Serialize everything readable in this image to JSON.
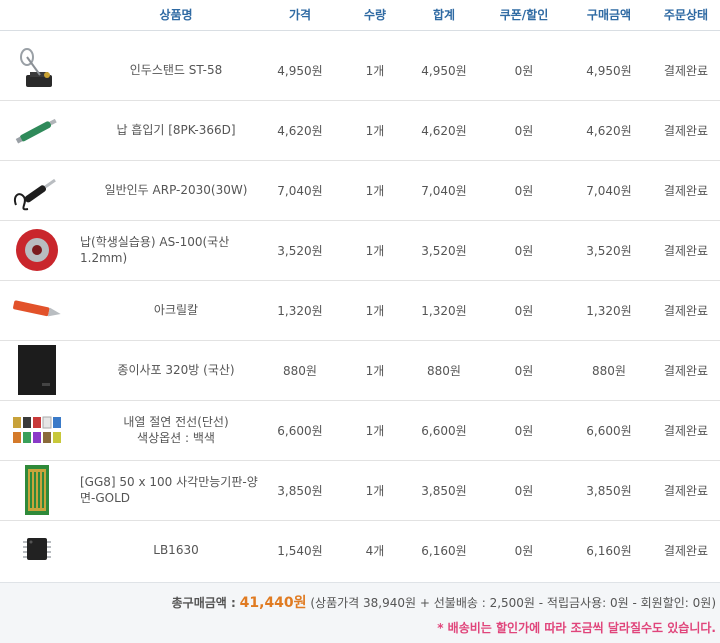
{
  "header": {
    "product": "상품명",
    "price": "가격",
    "qty": "수량",
    "total": "합계",
    "coupon": "쿠폰/할인",
    "paid": "구매금액",
    "status": "주문상태"
  },
  "rows": [
    {
      "icon": "soldering-stand-icon",
      "name": "인두스탠드 ST-58",
      "option": "",
      "price": "4,950원",
      "qty": "1개",
      "total": "4,950원",
      "coupon": "0원",
      "paid": "4,950원",
      "status": "결제완료"
    },
    {
      "icon": "solder-sucker-icon",
      "name": "납 흡입기 [8PK-366D]",
      "option": "",
      "price": "4,620원",
      "qty": "1개",
      "total": "4,620원",
      "coupon": "0원",
      "paid": "4,620원",
      "status": "결제완료"
    },
    {
      "icon": "soldering-iron-icon",
      "name": "일반인두 ARP-2030(30W)",
      "option": "",
      "price": "7,040원",
      "qty": "1개",
      "total": "7,040원",
      "coupon": "0원",
      "paid": "7,040원",
      "status": "결제완료"
    },
    {
      "icon": "solder-reel-icon",
      "name": "납(학생실습용) AS-100(국산 1.2mm)",
      "option": "",
      "price": "3,520원",
      "qty": "1개",
      "total": "3,520원",
      "coupon": "0원",
      "paid": "3,520원",
      "status": "결제완료"
    },
    {
      "icon": "acrylic-cutter-icon",
      "name": "아크릴칼",
      "option": "",
      "price": "1,320원",
      "qty": "1개",
      "total": "1,320원",
      "coupon": "0원",
      "paid": "1,320원",
      "status": "결제완료"
    },
    {
      "icon": "sandpaper-icon",
      "name": "종이사포 320방 (국산)",
      "option": "",
      "price": "880원",
      "qty": "1개",
      "total": "880원",
      "coupon": "0원",
      "paid": "880원",
      "status": "결제완료"
    },
    {
      "icon": "wire-spools-icon",
      "name": "내열 절연 전선(단선)",
      "option": "색상옵션 : 백색",
      "price": "6,600원",
      "qty": "1개",
      "total": "6,600원",
      "coupon": "0원",
      "paid": "6,600원",
      "status": "결제완료"
    },
    {
      "icon": "pcb-board-icon",
      "name": "[GG8] 50 x 100 사각만능기판-양면-GOLD",
      "option": "",
      "price": "3,850원",
      "qty": "1개",
      "total": "3,850원",
      "coupon": "0원",
      "paid": "3,850원",
      "status": "결제완료"
    },
    {
      "icon": "ic-chip-icon",
      "name": "LB1630",
      "option": "",
      "price": "1,540원",
      "qty": "4개",
      "total": "6,160원",
      "coupon": "0원",
      "paid": "6,160원",
      "status": "결제완료"
    }
  ],
  "summary": {
    "label": "총구매금액 :",
    "amount": "41,440원",
    "detail": "(상품가격 38,940원 + 선불배송 : 2,500원 - 적립금사용: 0원 - 회원할인: 0원)",
    "note": "* 배송비는 할인가에 따라 조금씩 달라질수도 있습니다."
  },
  "colors": {
    "header_text": "#2f6aa3",
    "amount": "#e07b22",
    "note": "#e0457b"
  }
}
